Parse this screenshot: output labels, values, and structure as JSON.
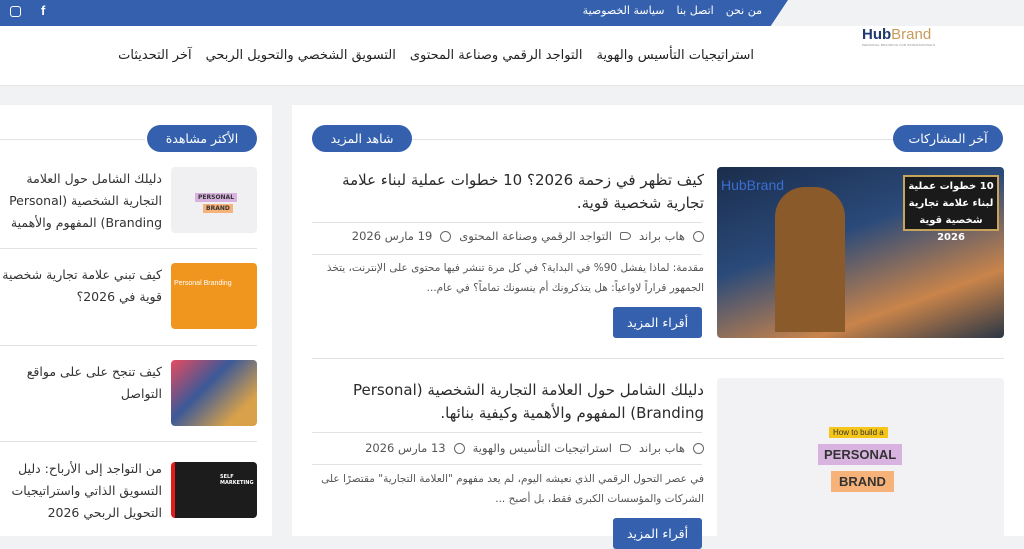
{
  "topbar": {
    "links": [
      "من نحن",
      "اتصل بنا",
      "سياسة الخصوصية"
    ],
    "social": [
      "instagram-icon",
      "facebook-icon"
    ]
  },
  "logo": {
    "hub": "Hub",
    "brand": "Brand",
    "tagline": "PERSONAL BRANDING FOR PROFESSIONALS"
  },
  "nav": [
    "استراتيجيات التأسيس والهوية",
    "التواجد الرقمي وصناعة المحتوى",
    "التسويق الشخصي والتحويل الربحي",
    "آخر التحديثات"
  ],
  "main": {
    "section_title": "آخر المشاركات",
    "more_label": "شاهد المزيد",
    "posts": [
      {
        "title": "كيف تظهر في زحمة 2026؟ 10 خطوات عملية لبناء علامة تجارية شخصية قوية.",
        "author": "هاب براند",
        "category": "التواجد الرقمي وصناعة المحتوى",
        "date": "19 مارس 2026",
        "excerpt": "مقدمة: لماذا يفشل 90% في البداية؟ في كل مرة تنشر فيها محتوى على الإنترنت، يتخذ الجمهور قراراً لاواعياً: هل يتذكرونك أم ينسونك تماماً؟ في عام...",
        "button": "أقراء المزيد",
        "image_text": "10 خطوات عملية لبناء علامة تجارية شخصية قوية 2026"
      },
      {
        "title": "دليلك الشامل حول العلامة التجارية الشخصية (Personal Branding) المفهوم والأهمية وكيفية بنائها.",
        "author": "هاب براند",
        "category": "استراتيجيات التأسيس والهوية",
        "date": "13 مارس 2026",
        "excerpt": "في عصر التحول الرقمي الذي نعيشه اليوم، لم يعد مفهوم \"العلامة التجارية\" مقتصرًا على الشركات والمؤسسات الكبرى فقط، بل أصبح ...",
        "button": "أقراء المزيد",
        "image_text": [
          "How to build a",
          "PERSONAL",
          "BRAND"
        ]
      }
    ]
  },
  "sidebar": {
    "section_title": "الأكثر مشاهدة",
    "items": [
      {
        "title": "دليلك الشامل حول العلامة التجارية الشخصية (Personal Branding) المفهوم والأهمية"
      },
      {
        "title": "كيف تبني علامة تجارية شخصية قوية في 2026؟",
        "thumb_text": "Personal Branding"
      },
      {
        "title": "كيف تنجح على على مواقع التواصل"
      },
      {
        "title": "من التواجد إلى الأرباح: دليل التسويق الذاتي واستراتيجيات التحويل الربحي 2026",
        "thumb_text": "SELF MARKETING"
      }
    ]
  },
  "colors": {
    "primary": "#3460ad"
  }
}
